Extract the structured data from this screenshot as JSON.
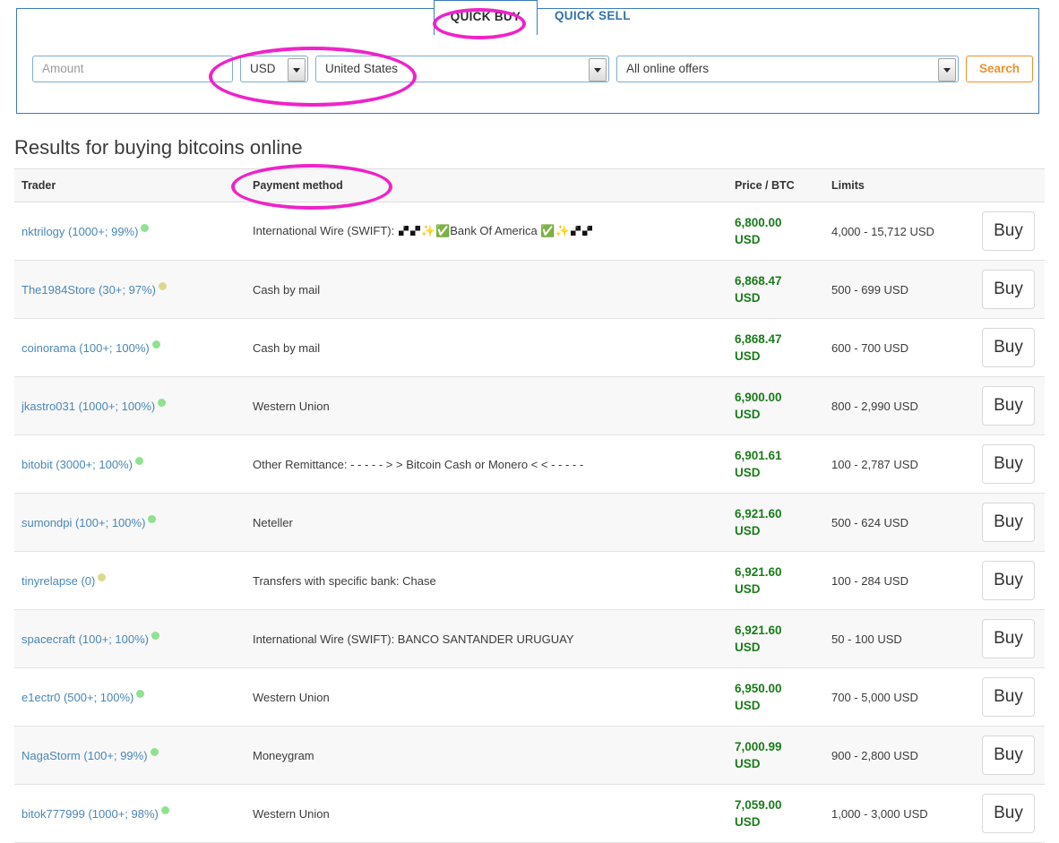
{
  "tabs": [
    {
      "label": "QUICK BUY",
      "active": true
    },
    {
      "label": "QUICK SELL",
      "active": false
    }
  ],
  "search_form": {
    "amount_placeholder": "Amount",
    "currency_value": "USD",
    "country_value": "United States",
    "method_value": "All online offers",
    "search_label": "Search"
  },
  "results": {
    "title": "Results for buying bitcoins online",
    "columns": [
      "Trader",
      "Payment method",
      "Price / BTC",
      "Limits",
      ""
    ],
    "rows": [
      {
        "trader": "nktrilogy (1000+; 99%)",
        "status": "green",
        "method_prefix": "International Wire (SWIFT): ",
        "method_emoji": true,
        "method_mid": "Bank Of America ",
        "price": "6,800.00",
        "currency": "USD",
        "limits": "4,000 - 15,712 USD",
        "buy_label": "Buy"
      },
      {
        "trader": "The1984Store (30+; 97%)",
        "status": "yellow",
        "method_prefix": "Cash by mail",
        "method_emoji": false,
        "method_mid": "",
        "price": "6,868.47",
        "currency": "USD",
        "limits": "500 - 699 USD",
        "buy_label": "Buy"
      },
      {
        "trader": "coinorama (100+; 100%)",
        "status": "green",
        "method_prefix": "Cash by mail",
        "method_emoji": false,
        "method_mid": "",
        "price": "6,868.47",
        "currency": "USD",
        "limits": "600 - 700 USD",
        "buy_label": "Buy"
      },
      {
        "trader": "jkastro031 (1000+; 100%)",
        "status": "green",
        "method_prefix": "Western Union",
        "method_emoji": false,
        "method_mid": "",
        "price": "6,900.00",
        "currency": "USD",
        "limits": "800 - 2,990 USD",
        "buy_label": "Buy"
      },
      {
        "trader": "bitobit (3000+; 100%)",
        "status": "green",
        "method_prefix": "Other Remittance: - - - - - > > Bitcoin Cash or Monero < < - - - - -",
        "method_emoji": false,
        "method_mid": "",
        "price": "6,901.61",
        "currency": "USD",
        "limits": "100 - 2,787 USD",
        "buy_label": "Buy"
      },
      {
        "trader": "sumondpi (100+; 100%)",
        "status": "green",
        "method_prefix": "Neteller",
        "method_emoji": false,
        "method_mid": "",
        "price": "6,921.60",
        "currency": "USD",
        "limits": "500 - 624 USD",
        "buy_label": "Buy"
      },
      {
        "trader": "tinyrelapse (0)",
        "status": "yellow",
        "method_prefix": "Transfers with specific bank: Chase",
        "method_emoji": false,
        "method_mid": "",
        "price": "6,921.60",
        "currency": "USD",
        "limits": "100 - 284 USD",
        "buy_label": "Buy"
      },
      {
        "trader": "spacecraft (100+; 100%)",
        "status": "green",
        "method_prefix": "International Wire (SWIFT): BANCO SANTANDER URUGUAY",
        "method_emoji": false,
        "method_mid": "",
        "price": "6,921.60",
        "currency": "USD",
        "limits": "50 - 100 USD",
        "buy_label": "Buy"
      },
      {
        "trader": "e1ectr0 (500+; 100%)",
        "status": "green",
        "method_prefix": "Western Union",
        "method_emoji": false,
        "method_mid": "",
        "price": "6,950.00",
        "currency": "USD",
        "limits": "700 - 5,000 USD",
        "buy_label": "Buy"
      },
      {
        "trader": "NagaStorm (100+; 99%)",
        "status": "green",
        "method_prefix": "Moneygram",
        "method_emoji": false,
        "method_mid": "",
        "price": "7,000.99",
        "currency": "USD",
        "limits": "900 - 2,800 USD",
        "buy_label": "Buy"
      },
      {
        "trader": "bitok777999 (1000+; 98%)",
        "status": "green",
        "method_prefix": "Western Union",
        "method_emoji": false,
        "method_mid": "",
        "price": "7,059.00",
        "currency": "USD",
        "limits": "1,000 - 3,000 USD",
        "buy_label": "Buy"
      }
    ]
  },
  "annotations": {
    "color": "#ee23c8",
    "targets": [
      "QUICK BUY",
      "USD / United States",
      "Payment method"
    ]
  },
  "colors": {
    "accent_blue": "#3a7bbf",
    "link_blue": "#4a87b8",
    "price_green": "#1a7c1a",
    "search_orange": "#f0912a",
    "annotation_magenta": "#ee23c8"
  }
}
